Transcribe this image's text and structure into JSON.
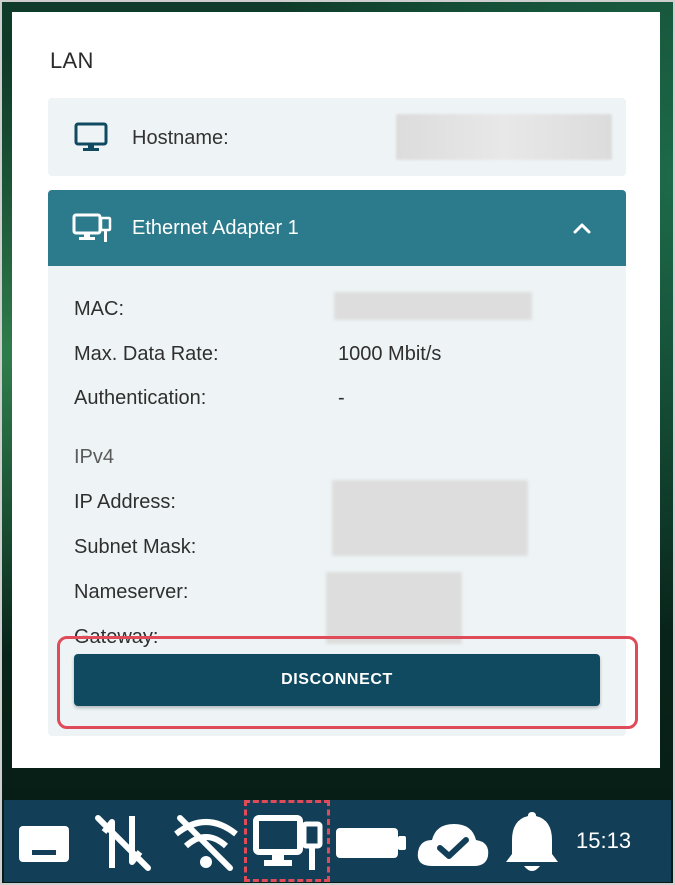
{
  "panel": {
    "title": "LAN",
    "hostname": {
      "label": "Hostname:",
      "icon": "monitor-icon"
    },
    "adapter": {
      "title": "Ethernet Adapter 1",
      "icon": "network-monitor-icon",
      "expanded": true,
      "rows": [
        {
          "label": "MAC:",
          "value": ""
        },
        {
          "label": "Max. Data Rate:",
          "value": "1000 Mbit/s"
        },
        {
          "label": "Authentication:",
          "value": "-"
        }
      ],
      "section": "IPv4",
      "ipv4_rows": [
        {
          "label": "IP Address:"
        },
        {
          "label": "Subnet Mask:"
        },
        {
          "label": "Nameserver:"
        },
        {
          "label": "Gateway:"
        }
      ],
      "disconnect_label": "DISCONNECT"
    }
  },
  "taskbar": {
    "icons": [
      "keyboard-icon",
      "mobile-data-off-icon",
      "wifi-off-icon",
      "network-monitor-icon",
      "battery-icon",
      "cloud-check-icon",
      "bell-icon"
    ],
    "time": "15:13"
  },
  "colors": {
    "accent": "#2c7b8c",
    "button": "#0f4a60",
    "taskbar": "#123f57",
    "highlight": "#e04b5a"
  }
}
